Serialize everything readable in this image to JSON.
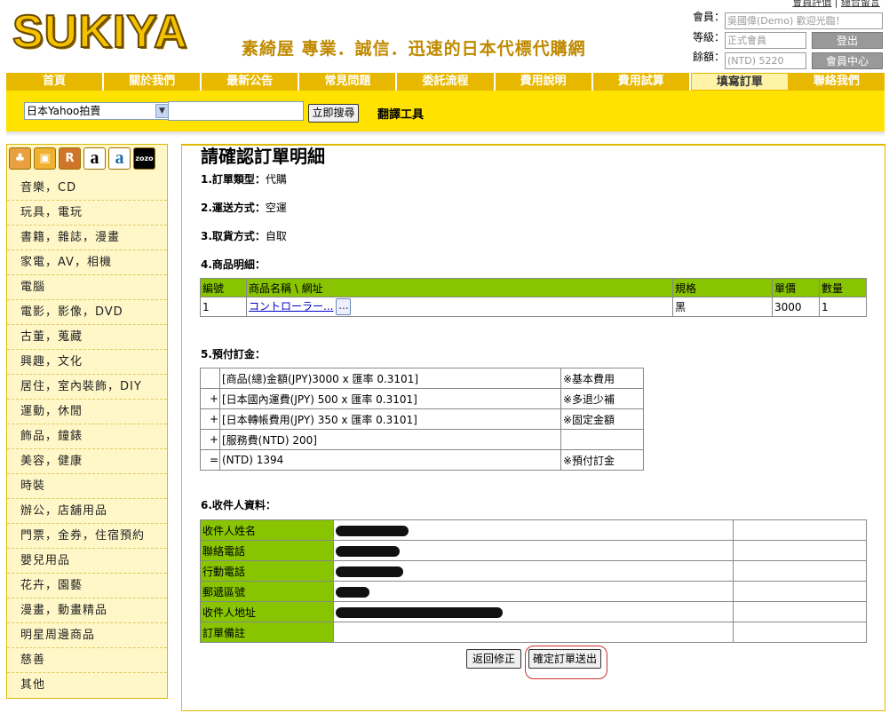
{
  "header": {
    "logo": "SUKIYA",
    "slogan": "素綺屋 專業．誠信．迅速的日本代標代購網",
    "top_links": [
      "會員評價",
      "總合留言"
    ],
    "member_label": "會員：",
    "member_value": "吳國偉(Demo) 歡迎光臨！",
    "level_label": "等級：",
    "level_value": "正式會員",
    "balance_label": "餘額：",
    "balance_value": "(NTD) 5220",
    "logout": "登出",
    "member_center": "會員中心"
  },
  "nav": [
    "首頁",
    "關於我們",
    "最新公告",
    "常見問題",
    "委託流程",
    "費用說明",
    "費用試算",
    "填寫訂單",
    "聯絡我們"
  ],
  "search": {
    "site": "日本Yahoo拍賣",
    "keyword": "",
    "button": "立即搜尋",
    "translate": "翻譯工具"
  },
  "sidebar": {
    "icons": [
      "yahoo-auction-icon",
      "shopping-bag-icon",
      "rakuten-icon",
      "amazon-icon",
      "amazon-alt-icon",
      "zozo-icon"
    ],
    "zozo_label": "zozo",
    "rakuten_label": "R",
    "amazon_label": "a",
    "categories": [
      "音樂，CD",
      "玩具，電玩",
      "書籍，雜誌，漫畫",
      "家電，AV，相機",
      "電腦",
      "電影，影像，DVD",
      "古董，蒐藏",
      "興趣，文化",
      "居住，室內裝飾，DIY",
      "運動，休閒",
      "飾品，鐘錶",
      "美容，健康",
      "時裝",
      "辦公，店舖用品",
      "門票，金券，住宿預約",
      "嬰兒用品",
      "花卉，園藝",
      "漫畫，動畫精品",
      "明星周邊商品",
      "慈善",
      "其他"
    ]
  },
  "order": {
    "title": "請確認訂單明細",
    "type_label": "1.訂單類型：",
    "type_value": "代購",
    "ship_label": "2.運送方式：",
    "ship_value": "空運",
    "pickup_label": "3.取貨方式：",
    "pickup_value": "自取",
    "items_label": "4.商品明細：",
    "items_headers": [
      "編號",
      "商品名稱 \\ 網址",
      "規格",
      "單價",
      "數量"
    ],
    "items": [
      {
        "no": "1",
        "name": "コントローラー...",
        "more": "...",
        "spec": "黑",
        "price": "3000",
        "qty": "1"
      }
    ],
    "deposit_label": "5.預付訂金：",
    "fees": [
      {
        "op": "",
        "desc": "[商品(總)金額(JPY)3000 x 匯率 0.3101]",
        "note": "※基本費用"
      },
      {
        "op": "+",
        "desc": "[日本國內運費(JPY) 500 x 匯率 0.3101]",
        "note": "※多退少補"
      },
      {
        "op": "+",
        "desc": "[日本轉帳費用(JPY) 350 x 匯率 0.3101]",
        "note": "※固定金額"
      },
      {
        "op": "+",
        "desc": "[服務費(NTD) 200]",
        "note": ""
      },
      {
        "op": "=",
        "desc": "(NTD) 1394",
        "note": "※預付訂金"
      }
    ],
    "recipient_label": "6.收件人資料：",
    "recipient_rows": [
      "收件人姓名",
      "聯絡電話",
      "行動電話",
      "郵遞區號",
      "收件人地址",
      "訂單備註"
    ],
    "back_button": "返回修正",
    "submit_button": "確定訂單送出"
  }
}
